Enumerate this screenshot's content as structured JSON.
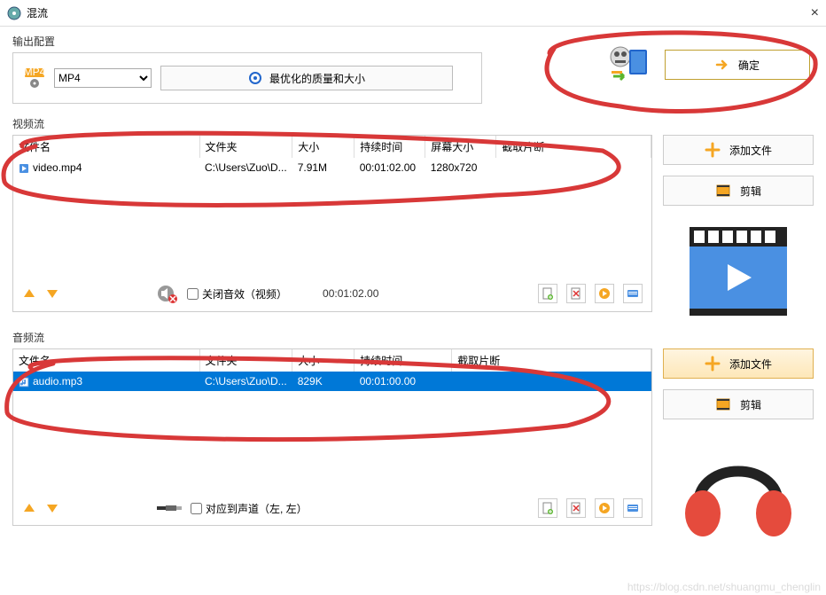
{
  "window": {
    "title": "混流",
    "close": "×"
  },
  "output": {
    "label": "输出配置",
    "format_selected": "MP4",
    "setting_label": "最优化的质量和大小"
  },
  "confirm": {
    "label": "确定"
  },
  "video": {
    "section_label": "视频流",
    "cols": {
      "name": "文件名",
      "folder": "文件夹",
      "size": "大小",
      "duration": "持续时间",
      "res": "屏幕大小",
      "segment": "截取片断"
    },
    "row": {
      "name": "video.mp4",
      "folder": "C:\\Users\\Zuo\\D...",
      "size": "7.91M",
      "duration": "00:01:02.00",
      "res": "1280x720"
    },
    "mute_label": "关闭音效（视频）",
    "total_duration": "00:01:02.00",
    "add_label": "添加文件",
    "edit_label": "剪辑"
  },
  "audio": {
    "section_label": "音频流",
    "cols": {
      "name": "文件名",
      "folder": "文件夹",
      "size": "大小",
      "duration": "持续时间",
      "segment": "截取片断"
    },
    "row": {
      "name": "audio.mp3",
      "folder": "C:\\Users\\Zuo\\D...",
      "size": "829K",
      "duration": "00:01:00.00"
    },
    "channel_label": "对应到声道（左, 左）",
    "add_label": "添加文件",
    "edit_label": "剪辑"
  },
  "watermark": "https://blog.csdn.net/shuangmu_chenglin"
}
